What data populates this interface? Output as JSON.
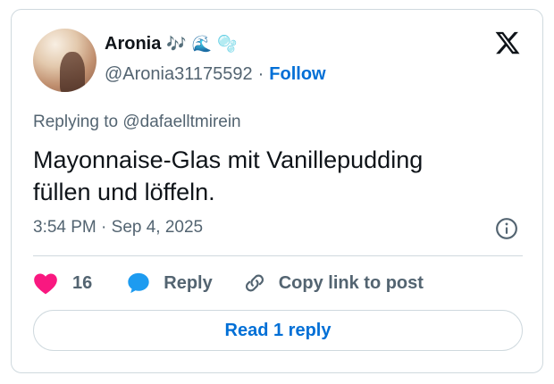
{
  "author": {
    "name": "Aronia",
    "emojis": [
      "🎶",
      "🌊",
      "🫧"
    ],
    "handle": "@Aronia31175592",
    "separator": "·",
    "follow_label": "Follow"
  },
  "tweet": {
    "replying_to": "Replying to @dafaelltmirein",
    "text_line1": "Mayonnaise-Glas mit Vanillepudding",
    "text_line2": "füllen und löffeln.",
    "timestamp": "3:54 PM · Sep 4, 2025"
  },
  "actions": {
    "like_count": "16",
    "reply_label": "Reply",
    "copy_label": "Copy link to post"
  },
  "read_replies_label": "Read 1 reply",
  "colors": {
    "accent": "#006fd6",
    "like": "#f91880",
    "reply_icon": "#1d9bf0",
    "secondary_text": "#536471",
    "border": "#cfd9de"
  },
  "icons": {
    "logo": "x-logo-icon",
    "info": "info-icon",
    "like": "heart-icon",
    "reply": "speech-bubble-icon",
    "copy": "link-icon"
  }
}
